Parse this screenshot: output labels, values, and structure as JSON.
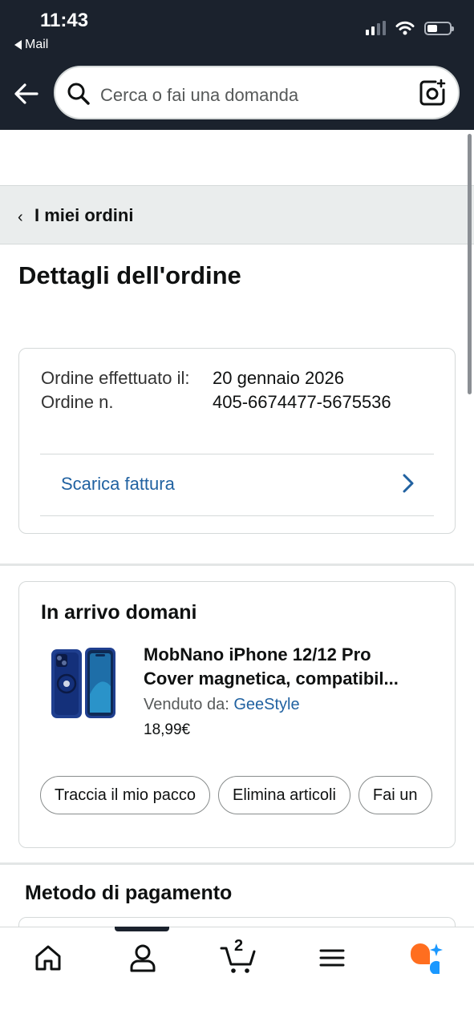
{
  "status_bar": {
    "time": "11:43",
    "back_app": "Mail"
  },
  "header": {
    "search_placeholder": "Cerca o fai una domanda"
  },
  "breadcrumb": {
    "label": "I miei ordini"
  },
  "page": {
    "title": "Dettagli dell'ordine"
  },
  "order_info": {
    "date_label": "Ordine effettuato il:",
    "date_value": "20 gennaio 2026",
    "number_label": "Ordine n.",
    "number_value": "405-6674477-5675536",
    "invoice_link": "Scarica fattura"
  },
  "shipment": {
    "heading": "In arrivo domani",
    "product_title_line1": "MobNano iPhone 12/12 Pro",
    "product_title_line2": "Cover magnetica, compatibil...",
    "seller_label": "Venduto da:",
    "seller_name": "GeeStyle",
    "price": "18,99€",
    "actions": [
      "Traccia il mio pacco",
      "Elimina articoli",
      "Fai un"
    ]
  },
  "payment": {
    "heading": "Metodo di pagamento"
  },
  "tabbar": {
    "tabs": [
      "home-icon",
      "account-icon",
      "cart-icon",
      "menu-icon",
      "rufus-icon"
    ],
    "cart_count": "2",
    "active_tab": "account"
  },
  "colors": {
    "header_bg": "#1b222d",
    "link": "#2162a1",
    "crumb_bg": "#eaeded",
    "rufus_orange": "#ff6e1f",
    "rufus_blue": "#1a98ff"
  }
}
